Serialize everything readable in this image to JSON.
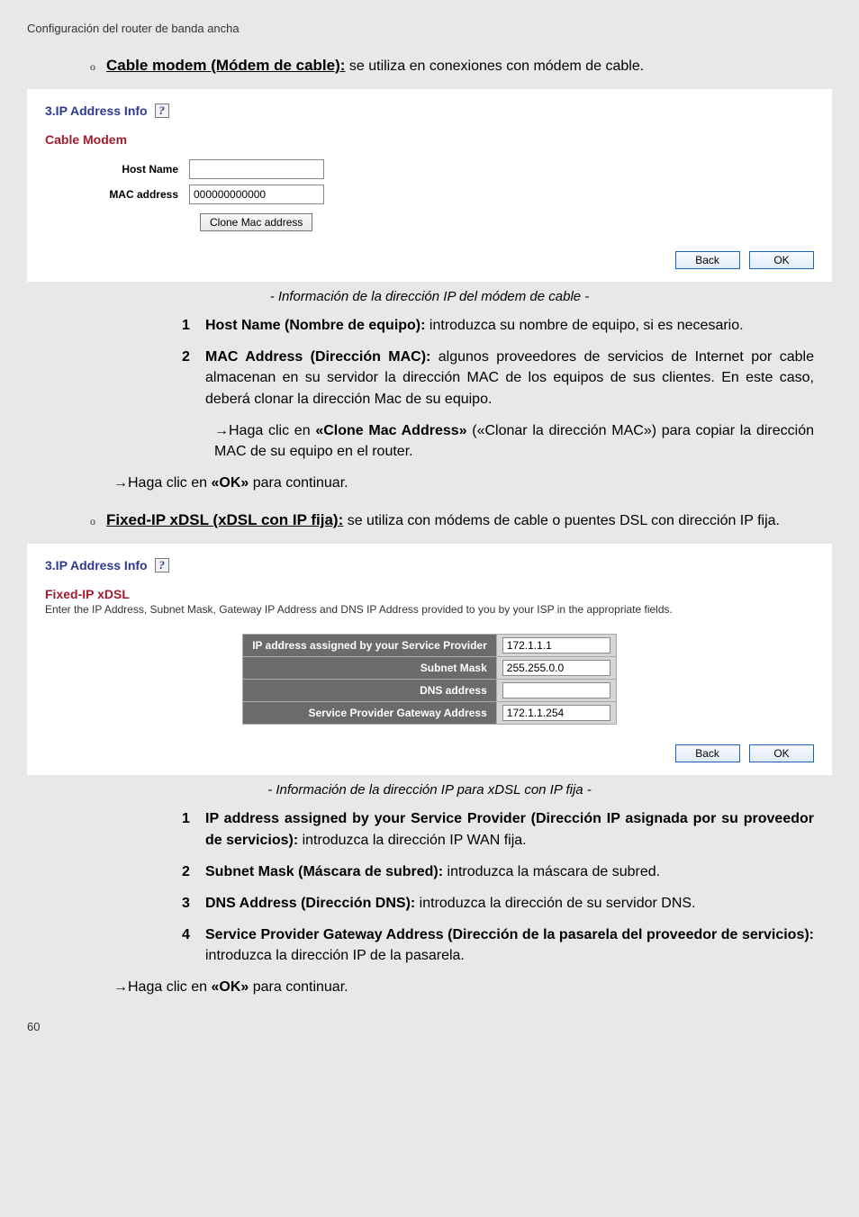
{
  "header": "Configuración del router de banda ancha",
  "pageNumber": "60",
  "cableModem": {
    "bullet": {
      "marker": "o",
      "title": "Cable modem (Módem de cable):",
      "rest": " se utiliza en conexiones con módem de cable."
    },
    "panel": {
      "sectionTitle": "3.IP Address Info",
      "subsection": "Cable Modem",
      "hostNameLabel": "Host Name",
      "macLabel": "MAC address",
      "macValue": "000000000000",
      "cloneBtn": "Clone Mac address",
      "backBtn": "Back",
      "okBtn": "OK"
    },
    "caption": "- Información de la dirección IP del módem de cable -",
    "items": [
      {
        "n": "1",
        "bold": "Host Name (Nombre de equipo):",
        "rest": " introduzca su nombre de equipo, si es necesario."
      },
      {
        "n": "2",
        "bold": "MAC Address (Dirección MAC):",
        "rest": " algunos proveedores de servicios de Internet por cable almacenan en su servidor la dirección MAC de los equipos de sus clientes. En este caso, deberá clonar la dirección Mac de su equipo."
      }
    ],
    "subArrow": {
      "pre": "→Haga clic en ",
      "bold": "«Clone Mac Address»",
      "rest": " («Clonar la dirección MAC») para copiar la dirección MAC de su equipo en el router."
    },
    "outerArrow": {
      "pre": "→Haga clic en ",
      "bold": "«OK»",
      "rest": " para continuar."
    }
  },
  "fixedIp": {
    "bullet": {
      "marker": "o",
      "title": "Fixed-IP xDSL (xDSL con IP fija):",
      "rest": " se utiliza con módems de cable o puentes DSL con dirección IP fija."
    },
    "panel": {
      "sectionTitle": "3.IP Address Info",
      "subsection": "Fixed-IP xDSL",
      "desc": "Enter the IP Address, Subnet Mask, Gateway IP Address and DNS IP Address provided to you by your ISP in the appropriate fields.",
      "rows": [
        {
          "label": "IP address assigned by your Service Provider",
          "value": "172.1.1.1"
        },
        {
          "label": "Subnet Mask",
          "value": "255.255.0.0"
        },
        {
          "label": "DNS address",
          "value": ""
        },
        {
          "label": "Service Provider Gateway Address",
          "value": "172.1.1.254"
        }
      ],
      "backBtn": "Back",
      "okBtn": "OK"
    },
    "caption": "- Información de la dirección IP para xDSL con IP fija -",
    "items": [
      {
        "n": "1",
        "bold": "IP address assigned by your Service Provider (Dirección IP asignada por su proveedor de servicios):",
        "rest": " introduzca la dirección IP WAN fija."
      },
      {
        "n": "2",
        "bold": "Subnet Mask (Máscara de subred):",
        "rest": " introduzca la máscara de subred."
      },
      {
        "n": "3",
        "bold": "DNS Address (Dirección DNS):",
        "rest": " introduzca la dirección de su servidor DNS."
      },
      {
        "n": "4",
        "bold": "Service Provider Gateway Address (Dirección de la pasarela del proveedor de servicios):",
        "rest": " introduzca la dirección IP de la pasarela."
      }
    ],
    "outerArrow": {
      "pre": "→Haga clic en ",
      "bold": "«OK»",
      "rest": " para continuar."
    }
  }
}
